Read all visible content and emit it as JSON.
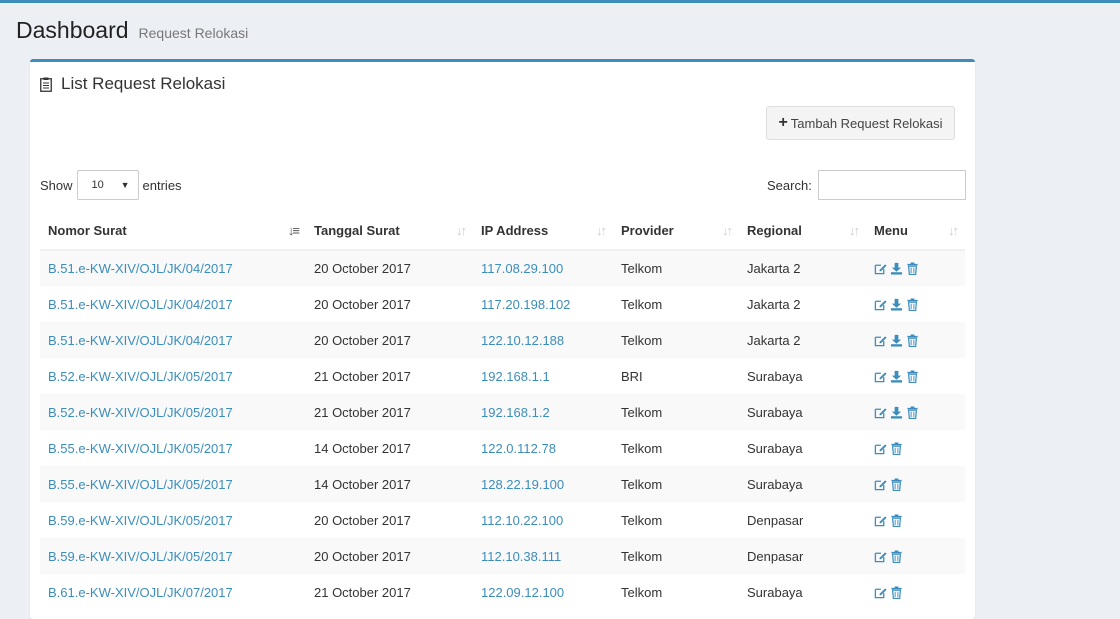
{
  "header": {
    "title": "Dashboard",
    "subtitle": "Request Relokasi"
  },
  "box": {
    "title": "List Request Relokasi",
    "add_button": "Tambah Request Relokasi",
    "length_prefix": "Show",
    "length_value": "10",
    "length_suffix": "entries",
    "search_label": "Search:",
    "search_value": ""
  },
  "table": {
    "columns": [
      "Nomor Surat",
      "Tanggal Surat",
      "IP Address",
      "Provider",
      "Regional",
      "Menu"
    ],
    "rows": [
      {
        "nomor": "B.51.e-KW-XIV/OJL/JK/04/2017",
        "tanggal": "20 October 2017",
        "ip": "117.08.29.100",
        "provider": "Telkom",
        "regional": "Jakarta 2",
        "actions": [
          "edit",
          "download",
          "delete"
        ]
      },
      {
        "nomor": "B.51.e-KW-XIV/OJL/JK/04/2017",
        "tanggal": "20 October 2017",
        "ip": "117.20.198.102",
        "provider": "Telkom",
        "regional": "Jakarta 2",
        "actions": [
          "edit",
          "download",
          "delete"
        ]
      },
      {
        "nomor": "B.51.e-KW-XIV/OJL/JK/04/2017",
        "tanggal": "20 October 2017",
        "ip": "122.10.12.188",
        "provider": "Telkom",
        "regional": "Jakarta 2",
        "actions": [
          "edit",
          "download",
          "delete"
        ]
      },
      {
        "nomor": "B.52.e-KW-XIV/OJL/JK/05/2017",
        "tanggal": "21 October 2017",
        "ip": "192.168.1.1",
        "provider": "BRI",
        "regional": "Surabaya",
        "actions": [
          "edit",
          "download",
          "delete"
        ]
      },
      {
        "nomor": "B.52.e-KW-XIV/OJL/JK/05/2017",
        "tanggal": "21 October 2017",
        "ip": "192.168.1.2",
        "provider": "Telkom",
        "regional": "Surabaya",
        "actions": [
          "edit",
          "download",
          "delete"
        ]
      },
      {
        "nomor": "B.55.e-KW-XIV/OJL/JK/05/2017",
        "tanggal": "14 October 2017",
        "ip": "122.0.112.78",
        "provider": "Telkom",
        "regional": "Surabaya",
        "actions": [
          "edit",
          "delete"
        ]
      },
      {
        "nomor": "B.55.e-KW-XIV/OJL/JK/05/2017",
        "tanggal": "14 October 2017",
        "ip": "128.22.19.100",
        "provider": "Telkom",
        "regional": "Surabaya",
        "actions": [
          "edit",
          "delete"
        ]
      },
      {
        "nomor": "B.59.e-KW-XIV/OJL/JK/05/2017",
        "tanggal": "20 October 2017",
        "ip": "112.10.22.100",
        "provider": "Telkom",
        "regional": "Denpasar",
        "actions": [
          "edit",
          "delete"
        ]
      },
      {
        "nomor": "B.59.e-KW-XIV/OJL/JK/05/2017",
        "tanggal": "20 October 2017",
        "ip": "112.10.38.111",
        "provider": "Telkom",
        "regional": "Denpasar",
        "actions": [
          "edit",
          "delete"
        ]
      },
      {
        "nomor": "B.61.e-KW-XIV/OJL/JK/07/2017",
        "tanggal": "21 October 2017",
        "ip": "122.09.12.100",
        "provider": "Telkom",
        "regional": "Surabaya",
        "actions": [
          "edit",
          "delete"
        ]
      }
    ]
  },
  "colors": {
    "accent": "#3c8dbc",
    "link": "#3c8dbc",
    "background": "#ecf0f5"
  },
  "icons": {
    "box_title": "clipboard-icon",
    "add": "plus-icon",
    "edit": "edit-icon",
    "download": "download-icon",
    "delete": "trash-icon"
  }
}
